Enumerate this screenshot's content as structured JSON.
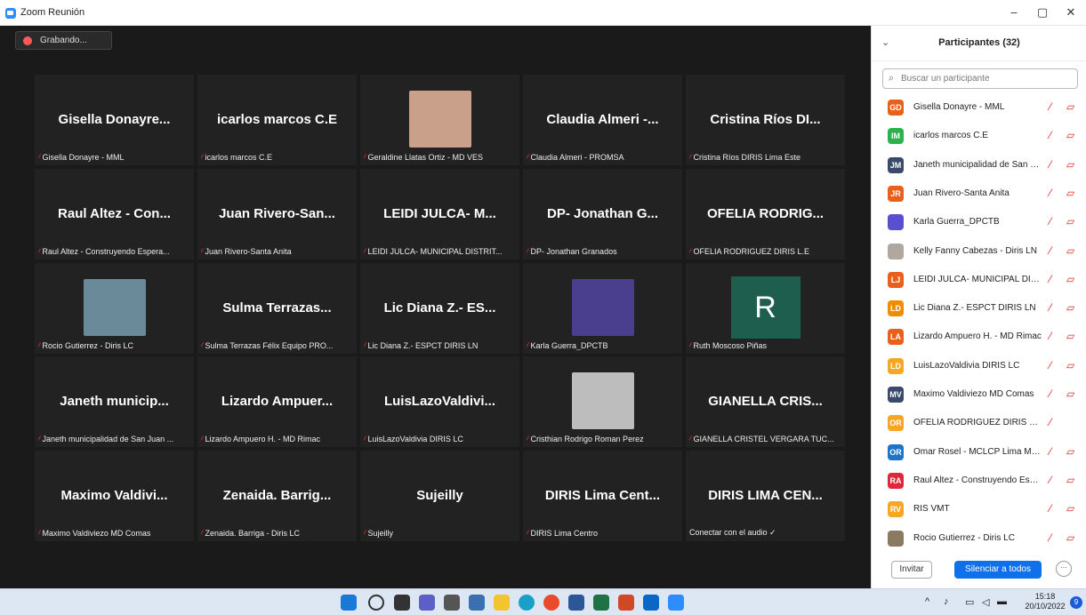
{
  "window": {
    "title": "Zoom Reunión",
    "minimize": "–",
    "restore": "▢",
    "close": "✕"
  },
  "recording": {
    "label": "Grabando..."
  },
  "tiles": [
    {
      "display": "Gisella  Donayre...",
      "label": "Gisella Donayre - MML",
      "muted": true
    },
    {
      "display": "icarlos marcos C.E",
      "label": "icarlos marcos C.E",
      "muted": true
    },
    {
      "display": "",
      "label": "Geraldine Llatas Ortiz - MD VES",
      "muted": true,
      "photo": true
    },
    {
      "display": "Claudia Almeri -...",
      "label": "Claudia Almeri - PROMSA",
      "muted": true
    },
    {
      "display": "Cristina Ríos DI...",
      "label": "Cristina Ríos DIRIS Lima Este",
      "muted": true
    },
    {
      "display": "Raul Altez - Con...",
      "label": "Raul Altez - Construyendo Espera...",
      "muted": true
    },
    {
      "display": "Juan Rivero-San...",
      "label": "Juan Rivero-Santa Anita",
      "muted": true
    },
    {
      "display": "LEIDI JULCA- M...",
      "label": "LEIDI JULCA- MUNICIPAL DISTRIT...",
      "muted": true
    },
    {
      "display": "DP- Jonathan G...",
      "label": "DP- Jonathan Granados",
      "muted": true
    },
    {
      "display": "OFELIA RODRIG...",
      "label": "OFELIA RODRIGUEZ DIRIS L.E",
      "muted": true
    },
    {
      "display": "",
      "label": "Rocio Gutierrez - Diris LC",
      "muted": true,
      "photo": true
    },
    {
      "display": "Sulma  Terrazas...",
      "label": "Sulma Terrazas Félix Equipo PRO...",
      "muted": true
    },
    {
      "display": "Lic Diana Z.- ES...",
      "label": "Lic Diana Z.- ESPCT DIRIS LN",
      "muted": true
    },
    {
      "display": "",
      "label": "Karla Guerra_DPCTB",
      "muted": true,
      "photo": true
    },
    {
      "display": "R",
      "label": "Ruth Moscoso Piñas",
      "muted": true,
      "letter": true
    },
    {
      "display": "Janeth  municip...",
      "label": "Janeth municipalidad de San Juan ...",
      "muted": true
    },
    {
      "display": "Lizardo  Ampuer...",
      "label": "Lizardo Ampuero H. - MD Rimac",
      "muted": true
    },
    {
      "display": "LuisLazoValdivi...",
      "label": "LuisLazoValdivia DIRIS LC",
      "muted": true
    },
    {
      "display": "",
      "label": "Cristhian Rodrigo Roman Perez",
      "muted": true,
      "photo": true
    },
    {
      "display": "GIANELLA  CRIS...",
      "label": "GIANELLA CRISTEL VERGARA TUC...",
      "muted": true
    },
    {
      "display": "Maximo  Valdivi...",
      "label": "Maximo Valdiviezo MD Comas",
      "muted": true
    },
    {
      "display": "Zenaida.  Barrig...",
      "label": "Zenaida. Barriga - Diris LC",
      "muted": true
    },
    {
      "display": "Sujeilly",
      "label": "Sujeilly",
      "muted": true
    },
    {
      "display": "DIRIS Lima Cent...",
      "label": "DIRIS Lima Centro",
      "muted": true
    },
    {
      "display": "DIRIS LIMA CEN...",
      "label": "Conectar con el audio ✓",
      "muted": false
    }
  ],
  "panel": {
    "title": "Participantes (32)",
    "search_placeholder": "Buscar un participante",
    "participants": [
      {
        "initials": "GD",
        "name": "Gisella Donayre - MML",
        "color": "#e8601c"
      },
      {
        "initials": "IM",
        "name": "icarlos marcos C.E",
        "color": "#2bb24c"
      },
      {
        "initials": "JM",
        "name": "Janeth municipalidad de San Jua...",
        "color": "#3a4a6b"
      },
      {
        "initials": "JR",
        "name": "Juan Rivero-Santa Anita",
        "color": "#e8601c"
      },
      {
        "initials": "",
        "name": "Karla Guerra_DPCTB",
        "color": "#5a4fcf"
      },
      {
        "initials": "",
        "name": "Kelly Fanny Cabezas - Diris LN",
        "color": "#b0a8a0"
      },
      {
        "initials": "LJ",
        "name": "LEIDI JULCA- MUNICIPAL DISTRI...",
        "color": "#e8601c"
      },
      {
        "initials": "LD",
        "name": "Lic Diana Z.- ESPCT DIRIS LN",
        "color": "#f08c00"
      },
      {
        "initials": "LA",
        "name": "Lizardo Ampuero H. - MD Rimac",
        "color": "#e8601c"
      },
      {
        "initials": "LD",
        "name": "LuisLazoValdivia DIRIS LC",
        "color": "#f5a623"
      },
      {
        "initials": "MV",
        "name": "Maximo Valdiviezo MD Comas",
        "color": "#3a4a6b"
      },
      {
        "initials": "OR",
        "name": "OFELIA RODRIGUEZ DIRIS L.E",
        "color": "#f5a623"
      },
      {
        "initials": "OR",
        "name": "Omar Rosel - MCLCP Lima Metro...",
        "color": "#1f73c8"
      },
      {
        "initials": "RA",
        "name": "Raul Altez - Construyendo Esper...",
        "color": "#e0263a"
      },
      {
        "initials": "RV",
        "name": "RIS VMT",
        "color": "#f5a623"
      },
      {
        "initials": "",
        "name": "Rocio Gutierrez - Diris LC",
        "color": "#8a7a60"
      }
    ],
    "invite": "Invitar",
    "mute_all": "Silenciar a todos",
    "more": "···"
  },
  "taskbar": {
    "time": "15:18",
    "date": "20/10/2022",
    "notifications": "9"
  }
}
